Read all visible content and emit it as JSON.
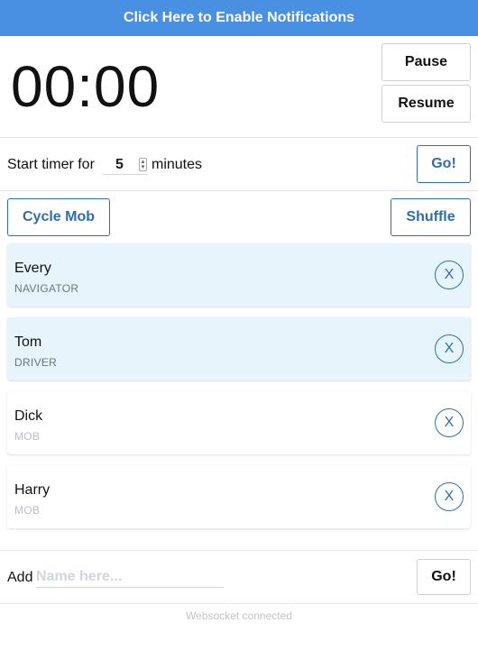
{
  "notification_bar": {
    "label": "Click Here to Enable Notifications"
  },
  "timer": {
    "display": "00:00",
    "pause_label": "Pause",
    "resume_label": "Resume"
  },
  "start_timer": {
    "prefix": "Start timer for",
    "minutes_value": "5",
    "suffix": "minutes",
    "go_label": "Go!"
  },
  "actions": {
    "cycle_label": "Cycle Mob",
    "shuffle_label": "Shuffle"
  },
  "mob": [
    {
      "name": "Every",
      "role": "NAVIGATOR",
      "active": true,
      "remove_label": "X"
    },
    {
      "name": "Tom",
      "role": "DRIVER",
      "active": true,
      "remove_label": "X"
    },
    {
      "name": "Dick",
      "role": "MOB",
      "active": false,
      "remove_label": "X"
    },
    {
      "name": "Harry",
      "role": "MOB",
      "active": false,
      "remove_label": "X"
    }
  ],
  "add_member": {
    "label": "Add",
    "placeholder": "Name here...",
    "go_label": "Go!"
  },
  "status": {
    "text": "Websocket connected"
  },
  "colors": {
    "notification_bg": "#4a90e2",
    "accent": "#2f6ea8",
    "active_card_bg": "#e8f4fc"
  }
}
